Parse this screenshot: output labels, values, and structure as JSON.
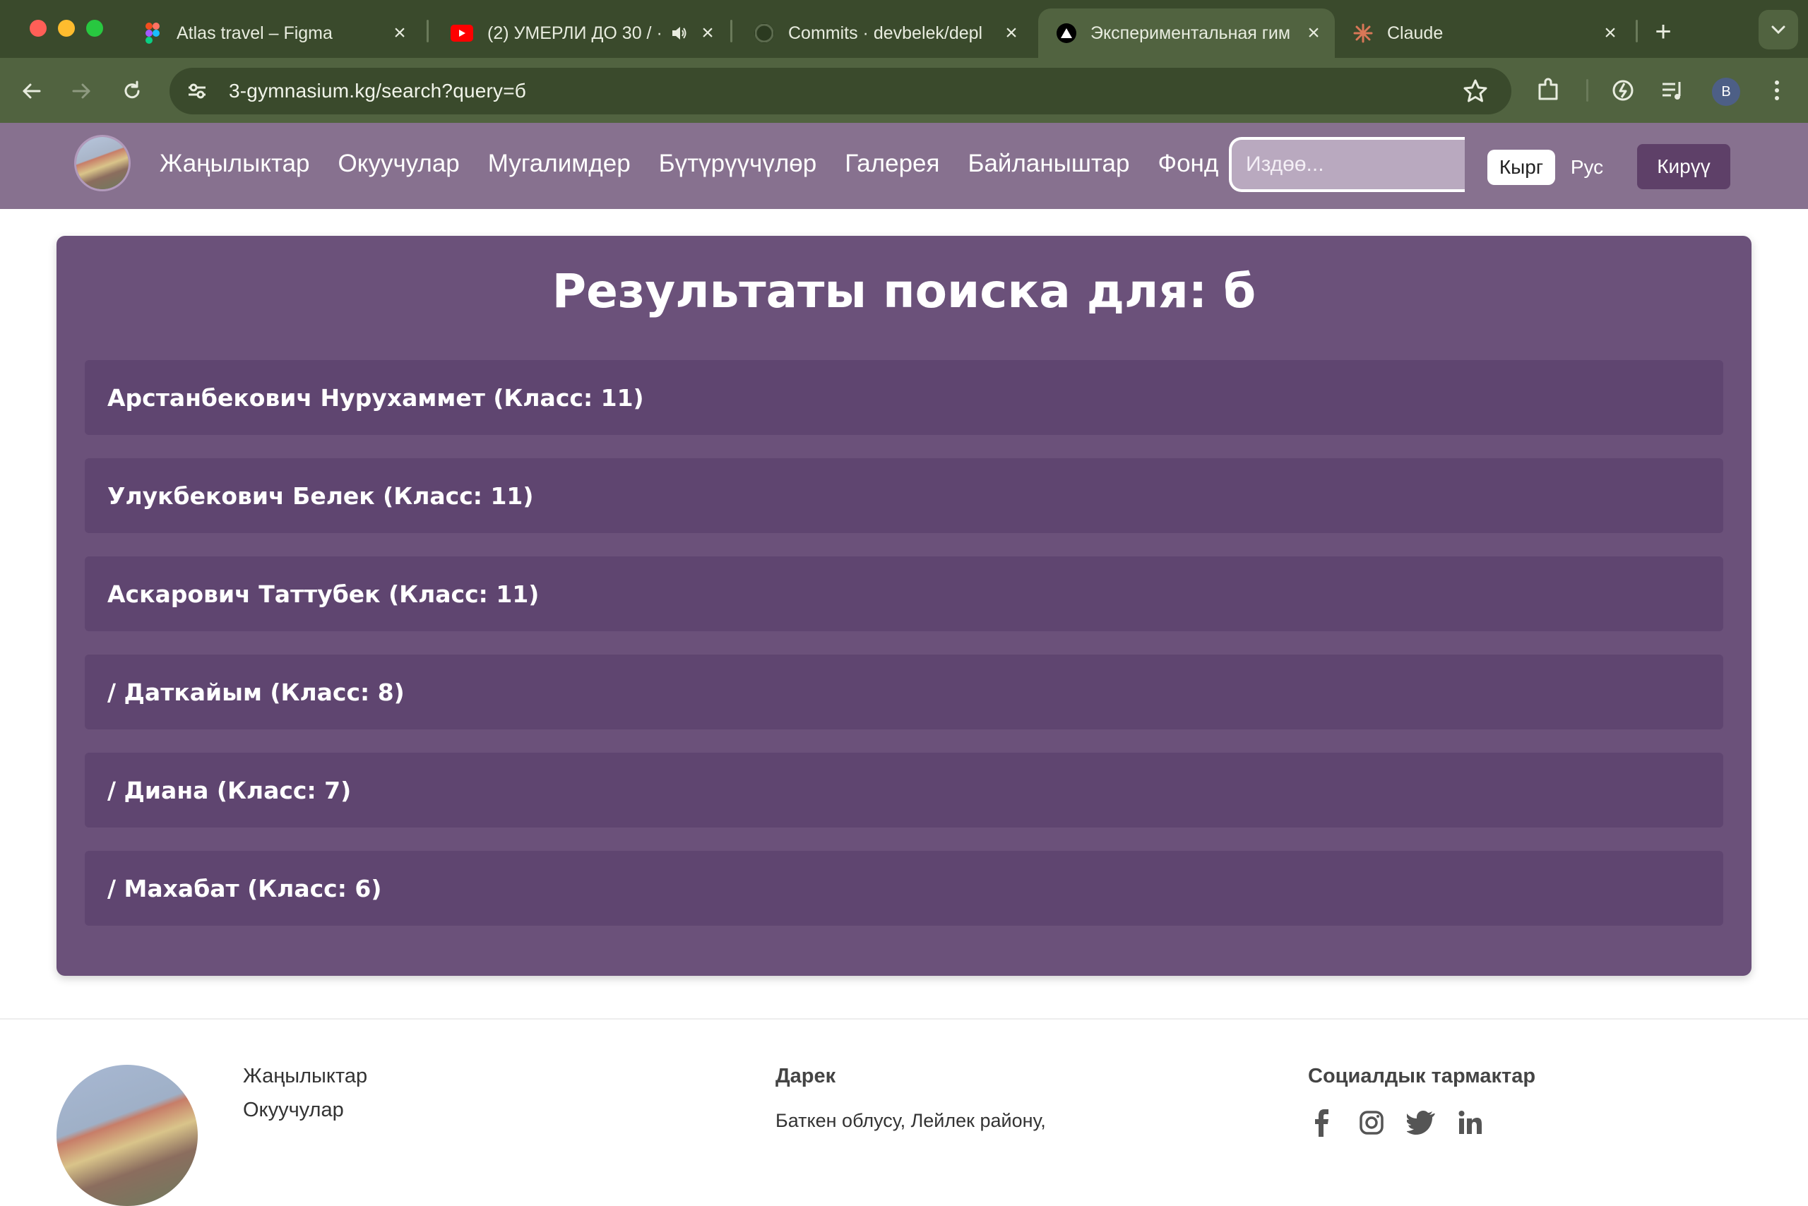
{
  "browser": {
    "tabs": [
      {
        "title": "Atlas travel – Figma",
        "icon": "figma-icon"
      },
      {
        "title": "(2) УМЕРЛИ ДО 30 / ·",
        "icon": "youtube-icon"
      },
      {
        "title": "Commits · devbelek/depl",
        "icon": "github-icon"
      },
      {
        "title": "Экспериментальная гим",
        "icon": "vercel-icon",
        "active": true
      },
      {
        "title": "Claude",
        "icon": "claude-icon"
      }
    ],
    "url": "3-gymnasium.kg/search?query=б",
    "profile_initial": "B"
  },
  "site": {
    "nav": [
      "Жаңылыктар",
      "Окуучулар",
      "Мугалимдер",
      "Бүтүрүүчүлөр",
      "Галерея",
      "Байланыштар",
      "Фонд"
    ],
    "search_placeholder": "Издөө...",
    "lang_kg": "Кырг",
    "lang_ru": "Рус",
    "login": "Кирүү"
  },
  "results": {
    "title": "Результаты поиска для: б",
    "items": [
      "Арстанбекович Нурухаммет (Класс: 11)",
      "Улукбекович Белек (Класс: 11)",
      "Аскарович Таттубек (Класс: 11)",
      "/ Даткайым (Класс: 8)",
      "/ Диана (Класс: 7)",
      "/ Махабат (Класс: 6)"
    ]
  },
  "footer": {
    "links": [
      "Жаңылыктар",
      "Окуучулар"
    ],
    "address_heading": "Дарек",
    "address_text": "Баткен облусу, Лейлек району,",
    "social_heading": "Социалдык тармактар"
  },
  "colors": {
    "header_bg": "#87718f",
    "card_bg": "#6b517a",
    "item_bg": "#5f4570",
    "login_bg": "#5e4068",
    "browser_frame": "#3a4a2c"
  }
}
